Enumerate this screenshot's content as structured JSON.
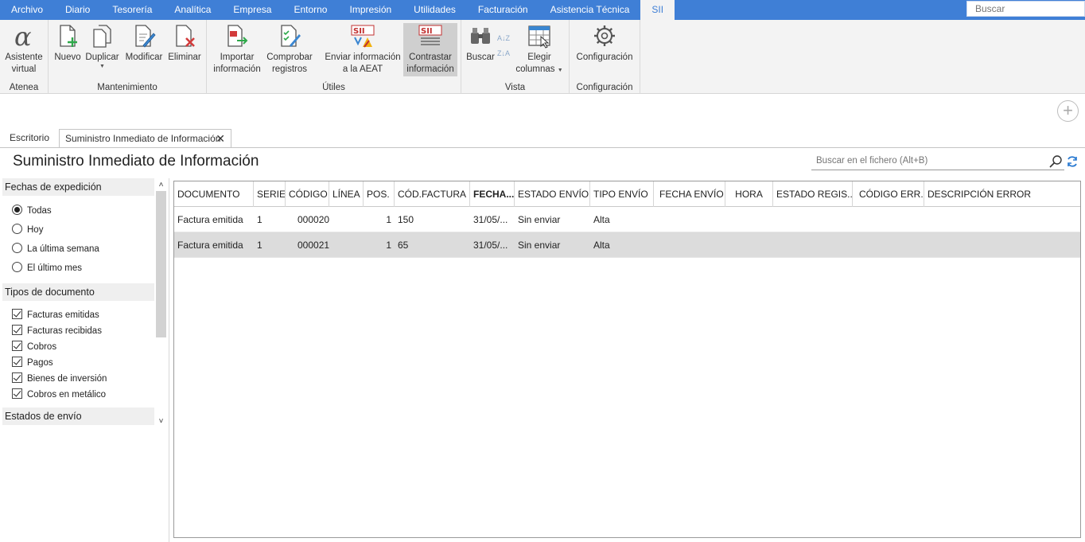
{
  "menu": {
    "items": [
      "Archivo",
      "Diario",
      "Tesorería",
      "Analítica",
      "Empresa",
      "Entorno",
      "Impresión",
      "Utilidades",
      "Facturación",
      "Asistencia Técnica",
      "SII"
    ],
    "active": "SII",
    "search_placeholder": "Buscar"
  },
  "ribbon": {
    "groups": {
      "atenea": "Atenea",
      "mantenimiento": "Mantenimiento",
      "utiles": "Útiles",
      "vista": "Vista",
      "configuracion": "Configuración"
    },
    "buttons": {
      "asistente": [
        "Asistente",
        "virtual"
      ],
      "nuevo": "Nuevo",
      "duplicar": "Duplicar",
      "modificar": "Modificar",
      "eliminar": "Eliminar",
      "importar": [
        "Importar",
        "información"
      ],
      "comprobar": [
        "Comprobar",
        "registros"
      ],
      "enviar": [
        "Enviar información",
        "a la AEAT"
      ],
      "contrastar": [
        "Contrastar",
        "información"
      ],
      "buscar": "Buscar",
      "elegir": [
        "Elegir",
        "columnas"
      ],
      "configuracion": "Configuración"
    },
    "sort_az": "A↓Z",
    "sort_za": "Z↓A"
  },
  "tabs": {
    "escritorio": "Escritorio",
    "sii": "Suministro Inmediato de Información",
    "close": "✕",
    "add": "+"
  },
  "page": {
    "title": "Suministro Inmediato de Información",
    "search_placeholder": "Buscar en el fichero (Alt+B)"
  },
  "filters": {
    "fechas_title": "Fechas de expedición",
    "fechas_options": [
      "Todas",
      "Hoy",
      "La última semana",
      "El último mes"
    ],
    "fechas_selected": 0,
    "tipos_title": "Tipos de documento",
    "tipos_options": [
      "Facturas emitidas",
      "Facturas recibidas",
      "Cobros",
      "Pagos",
      "Bienes de inversión",
      "Cobros en metálico"
    ],
    "estados_title": "Estados de envío",
    "scroll_up": "˄",
    "scroll_down": "˅"
  },
  "grid": {
    "columns": [
      "DOCUMENTO",
      "SERIE",
      "CÓDIGO",
      "LÍNEA",
      "POS.",
      "CÓD.FACTURA",
      "FECHA...",
      "ESTADO ENVÍO",
      "TIPO ENVÍO",
      "FECHA ENVÍO",
      "HORA",
      "ESTADO REGIS...",
      "CÓDIGO ERR...",
      "DESCRIPCIÓN ERROR"
    ],
    "rows": [
      {
        "documento": "Factura emitida",
        "serie": "1",
        "codigo": "000020",
        "linea": "",
        "pos": "1",
        "cod_factura": "150",
        "fecha": "31/05/...",
        "estado_envio": "Sin enviar",
        "tipo_envio": "Alta",
        "fecha_envio": "",
        "hora": "",
        "estado_registro": "",
        "codigo_error": "",
        "descripcion_error": ""
      },
      {
        "documento": "Factura emitida",
        "serie": "1",
        "codigo": "000021",
        "linea": "",
        "pos": "1",
        "cod_factura": "65",
        "fecha": "31/05/...",
        "estado_envio": "Sin enviar",
        "tipo_envio": "Alta",
        "fecha_envio": "",
        "hora": "",
        "estado_registro": "",
        "codigo_error": "",
        "descripcion_error": ""
      }
    ],
    "selected_row": 1
  },
  "colors": {
    "menubar": "#3f7fd6",
    "ribbon": "#f3f3f3",
    "selected_row": "#dcdcdc"
  }
}
